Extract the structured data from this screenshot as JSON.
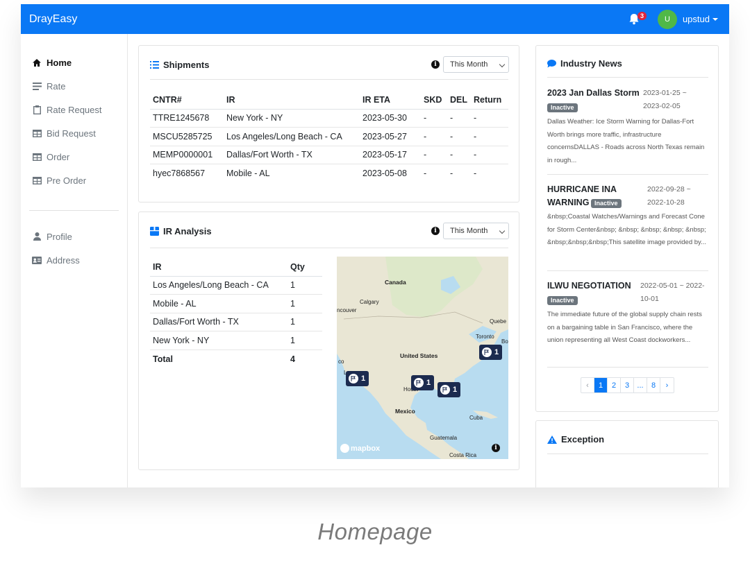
{
  "app": {
    "brand": "DrayEasy",
    "notifications": "3",
    "avatar_letter": "U",
    "username": "upstud"
  },
  "sidebar": {
    "items": [
      {
        "label": "Home",
        "icon": "home-icon"
      },
      {
        "label": "Rate",
        "icon": "lines-icon"
      },
      {
        "label": "Rate Request",
        "icon": "clipboard-icon"
      },
      {
        "label": "Bid Request",
        "icon": "table-icon"
      },
      {
        "label": "Order",
        "icon": "table-icon"
      },
      {
        "label": "Pre Order",
        "icon": "table-icon"
      }
    ],
    "secondary": [
      {
        "label": "Profile",
        "icon": "user-icon"
      },
      {
        "label": "Address",
        "icon": "address-card-icon"
      }
    ]
  },
  "shipments": {
    "title": "Shipments",
    "period": "This Month",
    "columns": [
      "CNTR#",
      "IR",
      "IR ETA",
      "SKD",
      "DEL",
      "Return"
    ],
    "rows": [
      [
        "TTRE1245678",
        "New York - NY",
        "2023-05-30",
        "-",
        "-",
        "-"
      ],
      [
        "MSCU5285725",
        "Los Angeles/Long Beach - CA",
        "2023-05-27",
        "-",
        "-",
        "-"
      ],
      [
        "MEMP0000001",
        "Dallas/Fort Worth - TX",
        "2023-05-17",
        "-",
        "-",
        "-"
      ],
      [
        "hyec7868567",
        "Mobile - AL",
        "2023-05-08",
        "-",
        "-",
        "-"
      ]
    ]
  },
  "ir_analysis": {
    "title": "IR Analysis",
    "period": "This Month",
    "columns": [
      "IR",
      "Qty"
    ],
    "rows": [
      [
        "Los Angeles/Long Beach - CA",
        "1"
      ],
      [
        "Mobile - AL",
        "1"
      ],
      [
        "Dallas/Fort Worth - TX",
        "1"
      ],
      [
        "New York - NY",
        "1"
      ]
    ],
    "total_label": "Total",
    "total_value": "4",
    "map": {
      "labels": [
        "Canada",
        "Calgary",
        "ncouver",
        "Quebe",
        "Toronto",
        "Bo",
        "United States",
        "co",
        "Los",
        "Houst",
        "Mexico",
        "Cuba",
        "Guatemala",
        "Costa Rica"
      ],
      "markers": [
        "1",
        "1",
        "1",
        "1"
      ],
      "attribution": "mapbox"
    }
  },
  "news": {
    "title": "Industry News",
    "items": [
      {
        "title": "2023 Jan Dallas Storm",
        "date": "2023-01-25 ~ 2023-02-05",
        "status": "Inactive",
        "body": "Dallas Weather: Ice Storm Warning for Dallas-Fort Worth brings more traffic, infrastructure concernsDALLAS - Roads across North Texas remain in rough..."
      },
      {
        "title": "HURRICANE INA WARNING",
        "date": "2022-09-28 ~ 2022-10-28",
        "status": "Inactive",
        "body": "&nbsp;Coastal Watches/Warnings and Forecast Cone for Storm Center&nbsp; &nbsp; &nbsp; &nbsp; &nbsp; &nbsp;&nbsp;&nbsp;This satellite image provided by..."
      },
      {
        "title": "ILWU NEGOTIATION",
        "date": "2022-05-01 ~ 2022-10-01",
        "status": "Inactive",
        "body": "The immediate future of the global supply chain rests on a bargaining table in San Francisco, where the union representing all West Coast dockworkers..."
      }
    ],
    "pagination": [
      "‹",
      "1",
      "2",
      "3",
      "...",
      "8",
      "›"
    ],
    "current_page": "1"
  },
  "exception": {
    "title": "Exception"
  },
  "caption": "Homepage",
  "colors": {
    "primary": "#0a78f5",
    "avatar": "#50b848",
    "badge": "#e0243b",
    "marker": "#1c2b4f",
    "tag": "#6c757d"
  }
}
